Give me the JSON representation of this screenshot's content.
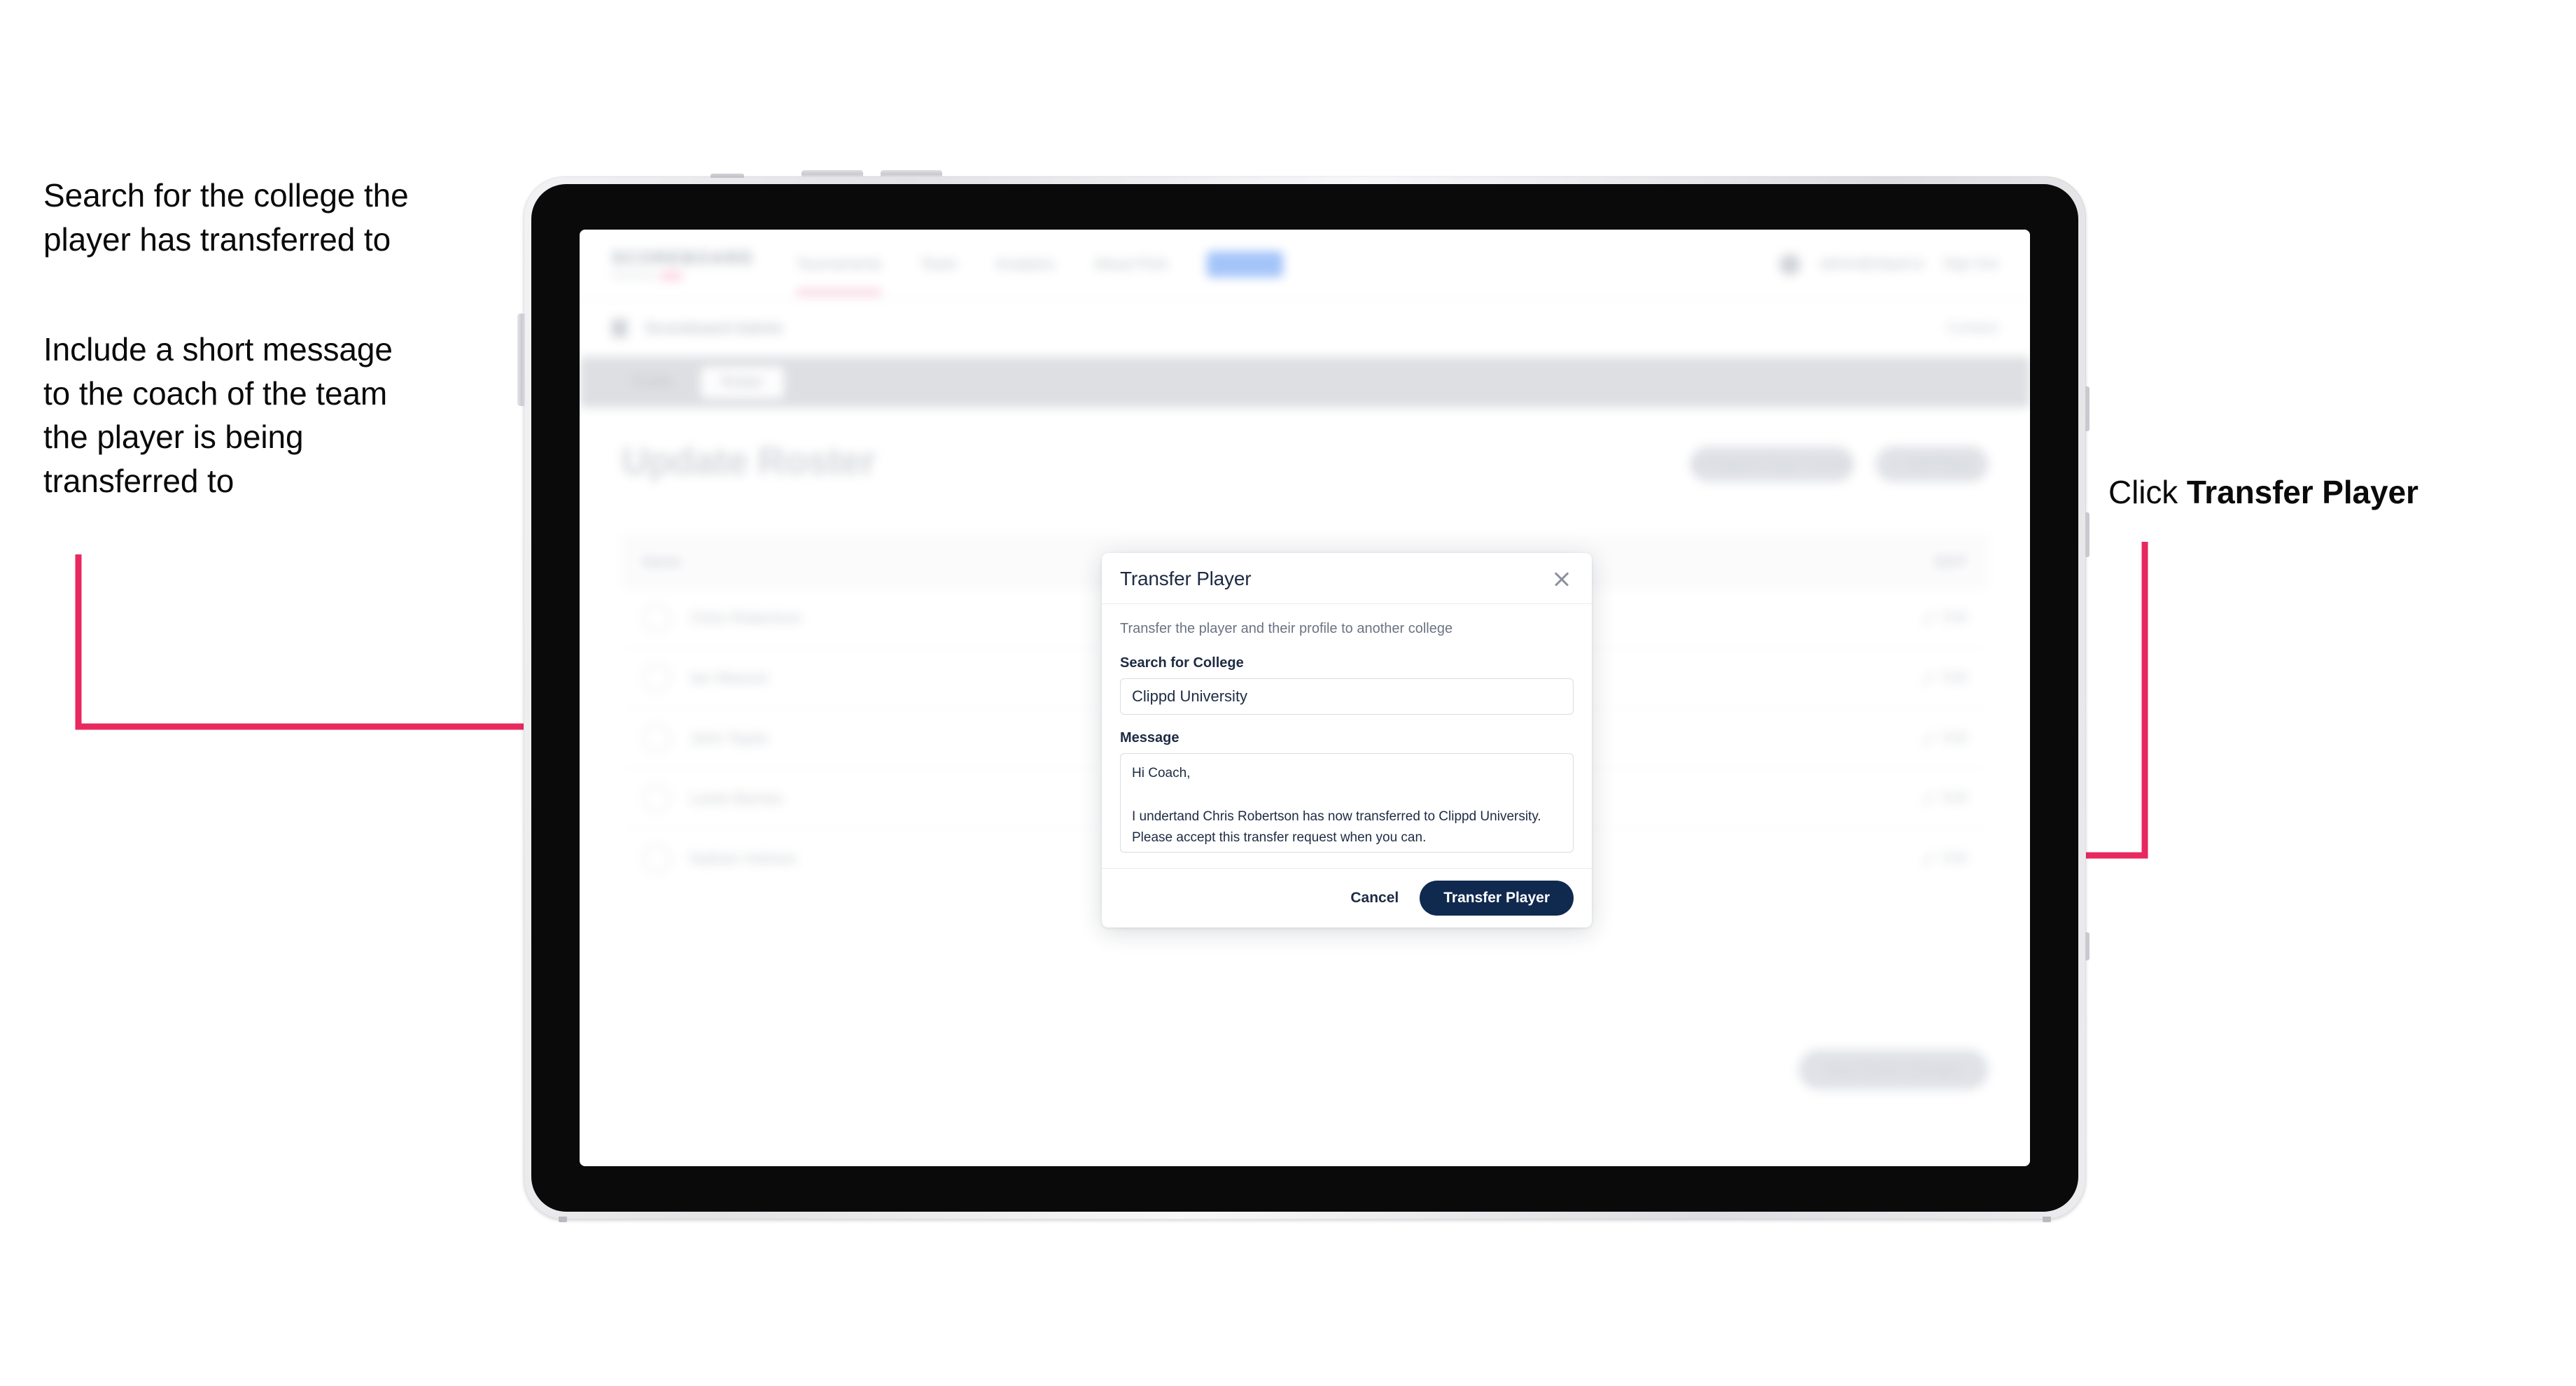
{
  "annotations": {
    "left_1": "Search for the college the\nplayer has transferred to",
    "left_2": "Include a short message\nto the coach of the team\nthe player is being\ntransferred to",
    "right_1_prefix": "Click ",
    "right_1_bold": "Transfer Player",
    "arrow_color": "#e8285f"
  },
  "app": {
    "brand": {
      "word": "SCOREBOARD",
      "sub": "Powered by",
      "sub_mark": "clippd"
    },
    "nav": [
      {
        "label": "Tournaments"
      },
      {
        "label": "Team"
      },
      {
        "label": "Analytics"
      },
      {
        "label": "About PGA"
      },
      {
        "label": "Admin"
      }
    ],
    "user": {
      "name": "admin@clippd.io",
      "sign_out": "Sign Out"
    },
    "breadcrumb": {
      "label": "Scoreboard Admin",
      "right": "Contact"
    },
    "tabs": [
      {
        "label": "Profile",
        "selected": false
      },
      {
        "label": "Roster",
        "selected": true
      }
    ],
    "page": {
      "title": "Update Roster",
      "actions": [
        {
          "label": "Request Player Transfer",
          "icon": "transfer-icon"
        },
        {
          "label": "Add Player",
          "icon": "plus-icon"
        }
      ],
      "table": {
        "columns": [
          "Name",
          "EDIT"
        ],
        "rows": [
          {
            "name": "Chris Robertson",
            "action": "Edit"
          },
          {
            "name": "Ian Weaver",
            "action": "Edit"
          },
          {
            "name": "John Taylor",
            "action": "Edit"
          },
          {
            "name": "Lewis Barnes",
            "action": "Edit"
          },
          {
            "name": "Nathan Holmes",
            "action": "Edit"
          }
        ]
      },
      "save_label": "Save Roster Changes"
    }
  },
  "modal": {
    "title": "Transfer Player",
    "close_icon": "close-icon",
    "description": "Transfer the player and their profile to another college",
    "fields": [
      {
        "label": "Search for College",
        "value": "Clippd University",
        "placeholder": "Search for College"
      },
      {
        "label": "Message",
        "value": "Hi Coach,\n\nI undertand Chris Robertson has now transferred to Clippd University. Please accept this transfer request when you can.",
        "placeholder": "Message"
      }
    ],
    "cancel_label": "Cancel",
    "submit_label": "Transfer Player",
    "submit_color": "#10294f"
  }
}
